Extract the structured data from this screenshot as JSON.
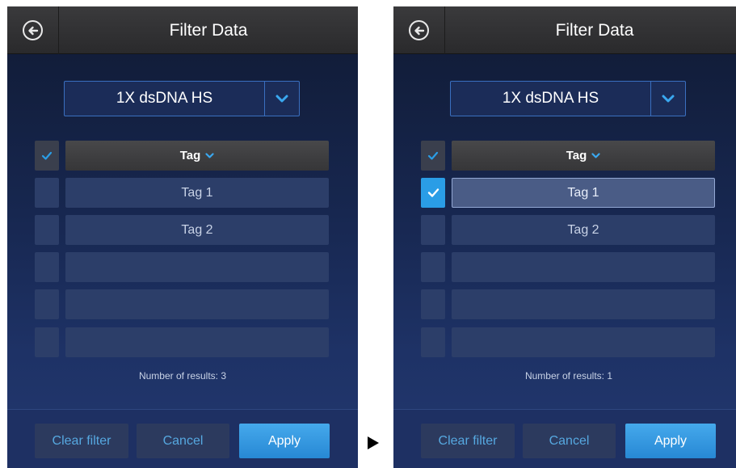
{
  "screens": [
    {
      "title": "Filter Data",
      "assay": "1X dsDNA HS",
      "column_header": "Tag",
      "rows": [
        {
          "label": "Tag 1",
          "checked": false
        },
        {
          "label": "Tag 2",
          "checked": false
        },
        {
          "label": "",
          "checked": false
        },
        {
          "label": "",
          "checked": false
        },
        {
          "label": "",
          "checked": false
        }
      ],
      "results_text": "Number of results: 3",
      "buttons": {
        "clear": "Clear filter",
        "cancel": "Cancel",
        "apply": "Apply"
      }
    },
    {
      "title": "Filter Data",
      "assay": "1X dsDNA HS",
      "column_header": "Tag",
      "rows": [
        {
          "label": "Tag 1",
          "checked": true
        },
        {
          "label": "Tag 2",
          "checked": false
        },
        {
          "label": "",
          "checked": false
        },
        {
          "label": "",
          "checked": false
        },
        {
          "label": "",
          "checked": false
        }
      ],
      "results_text": "Number of results: 1",
      "buttons": {
        "clear": "Clear filter",
        "cancel": "Cancel",
        "apply": "Apply"
      }
    }
  ],
  "icons": {
    "back": "back-arrow-circle-icon",
    "dropdown": "chevron-down-icon",
    "check": "checkmark-icon",
    "transition": "play-arrow-icon"
  },
  "colors": {
    "accent": "#2a9de6",
    "apply_button": "#2788d4",
    "secondary_button_text": "#56a8e0"
  }
}
